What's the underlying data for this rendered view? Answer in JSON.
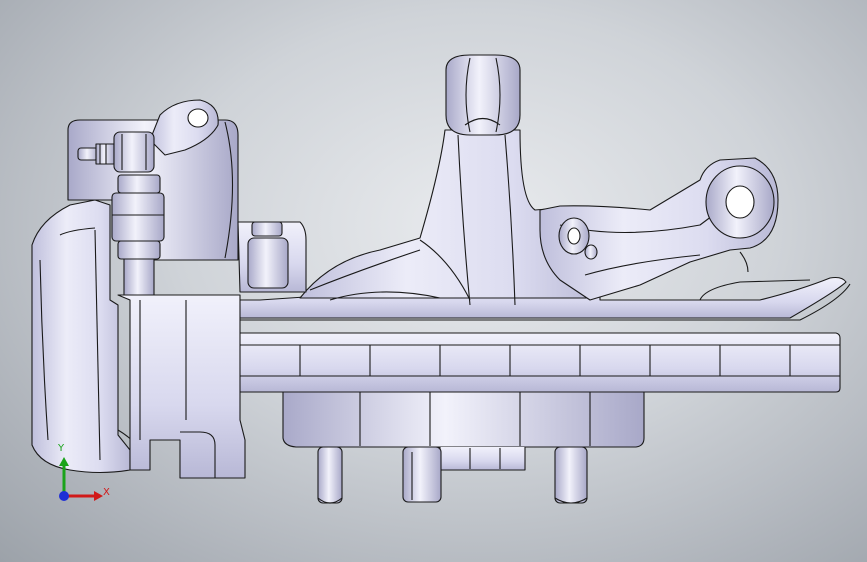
{
  "window": {
    "background_colors": [
      "#e9ebee",
      "#aeb3ba"
    ],
    "part_fill": "#e3e3f4",
    "part_shade": "#c3c3df",
    "edge_color": "#1a1a1a"
  },
  "triad": {
    "x_label": "X",
    "y_label": "Y",
    "x_color": "#d11919",
    "y_color": "#1aa31a",
    "z_color": "#1f2fd6"
  }
}
